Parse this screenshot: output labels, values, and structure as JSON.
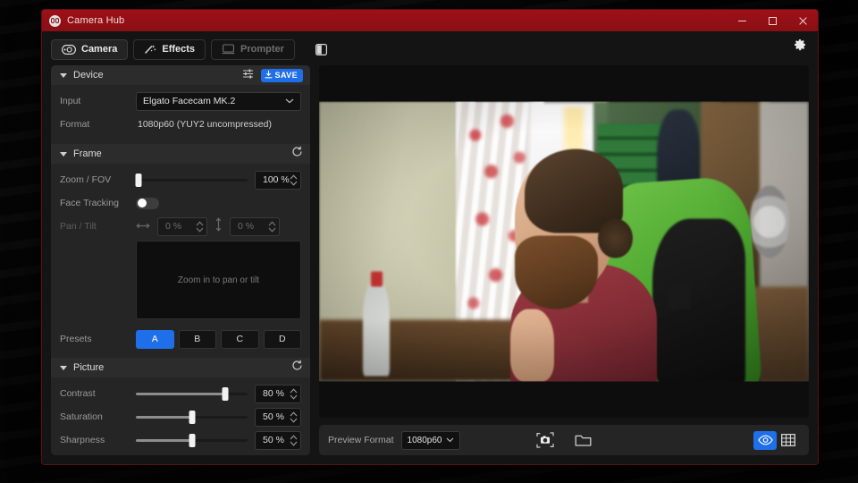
{
  "window": {
    "title": "Camera Hub",
    "logo_icon": "camera-hub-logo-icon",
    "minimize_label": "Minimize",
    "maximize_label": "Maximize",
    "close_label": "Close"
  },
  "toolbar": {
    "tabs": [
      {
        "label": "Camera",
        "icon": "camera-icon",
        "active": true
      },
      {
        "label": "Effects",
        "icon": "magic-wand-icon",
        "active": false
      },
      {
        "label": "Prompter",
        "icon": "prompter-screen-icon",
        "active": false
      }
    ],
    "panel_toggle_icon": "sidebar-toggle-icon",
    "settings_icon": "gear-icon"
  },
  "device": {
    "title": "Device",
    "filter_icon": "sliders-icon",
    "save_label": "SAVE",
    "save_icon": "download-icon",
    "input_label": "Input",
    "input_value": "Elgato Facecam MK.2",
    "format_label": "Format",
    "format_value": "1080p60 (YUY2 uncompressed)"
  },
  "frame": {
    "title": "Frame",
    "reset_icon": "reset-icon",
    "zoom_label": "Zoom / FOV",
    "zoom_value": "100 %",
    "zoom_percent": 0,
    "face_tracking_label": "Face Tracking",
    "face_tracking_on": false,
    "pan_tilt_label": "Pan / Tilt",
    "pan_icon": "horizontal-arrows-icon",
    "pan_value": "0 %",
    "tilt_icon": "vertical-arrows-icon",
    "tilt_value": "0 %",
    "pad_hint": "Zoom in to pan or tilt",
    "presets_label": "Presets",
    "presets": [
      {
        "label": "A",
        "active": true
      },
      {
        "label": "B",
        "active": false
      },
      {
        "label": "C",
        "active": false
      },
      {
        "label": "D",
        "active": false
      }
    ]
  },
  "picture": {
    "title": "Picture",
    "reset_icon": "reset-icon",
    "sliders": [
      {
        "label": "Contrast",
        "value": "80 %",
        "percent": 80
      },
      {
        "label": "Saturation",
        "value": "50 %",
        "percent": 50
      },
      {
        "label": "Sharpness",
        "value": "50 %",
        "percent": 50
      }
    ]
  },
  "preview": {
    "format_label": "Preview Format",
    "format_value": "1080p60",
    "snapshot_icon": "camera-capture-icon",
    "folder_icon": "folder-icon",
    "eye_icon": "eye-icon",
    "grid_icon": "grid-icon",
    "eye_active": true,
    "grid_active": false
  },
  "colors": {
    "accent": "#1f6feb",
    "titlebar": "#9d1117",
    "panel": "#252525",
    "app_bg": "#141414"
  }
}
